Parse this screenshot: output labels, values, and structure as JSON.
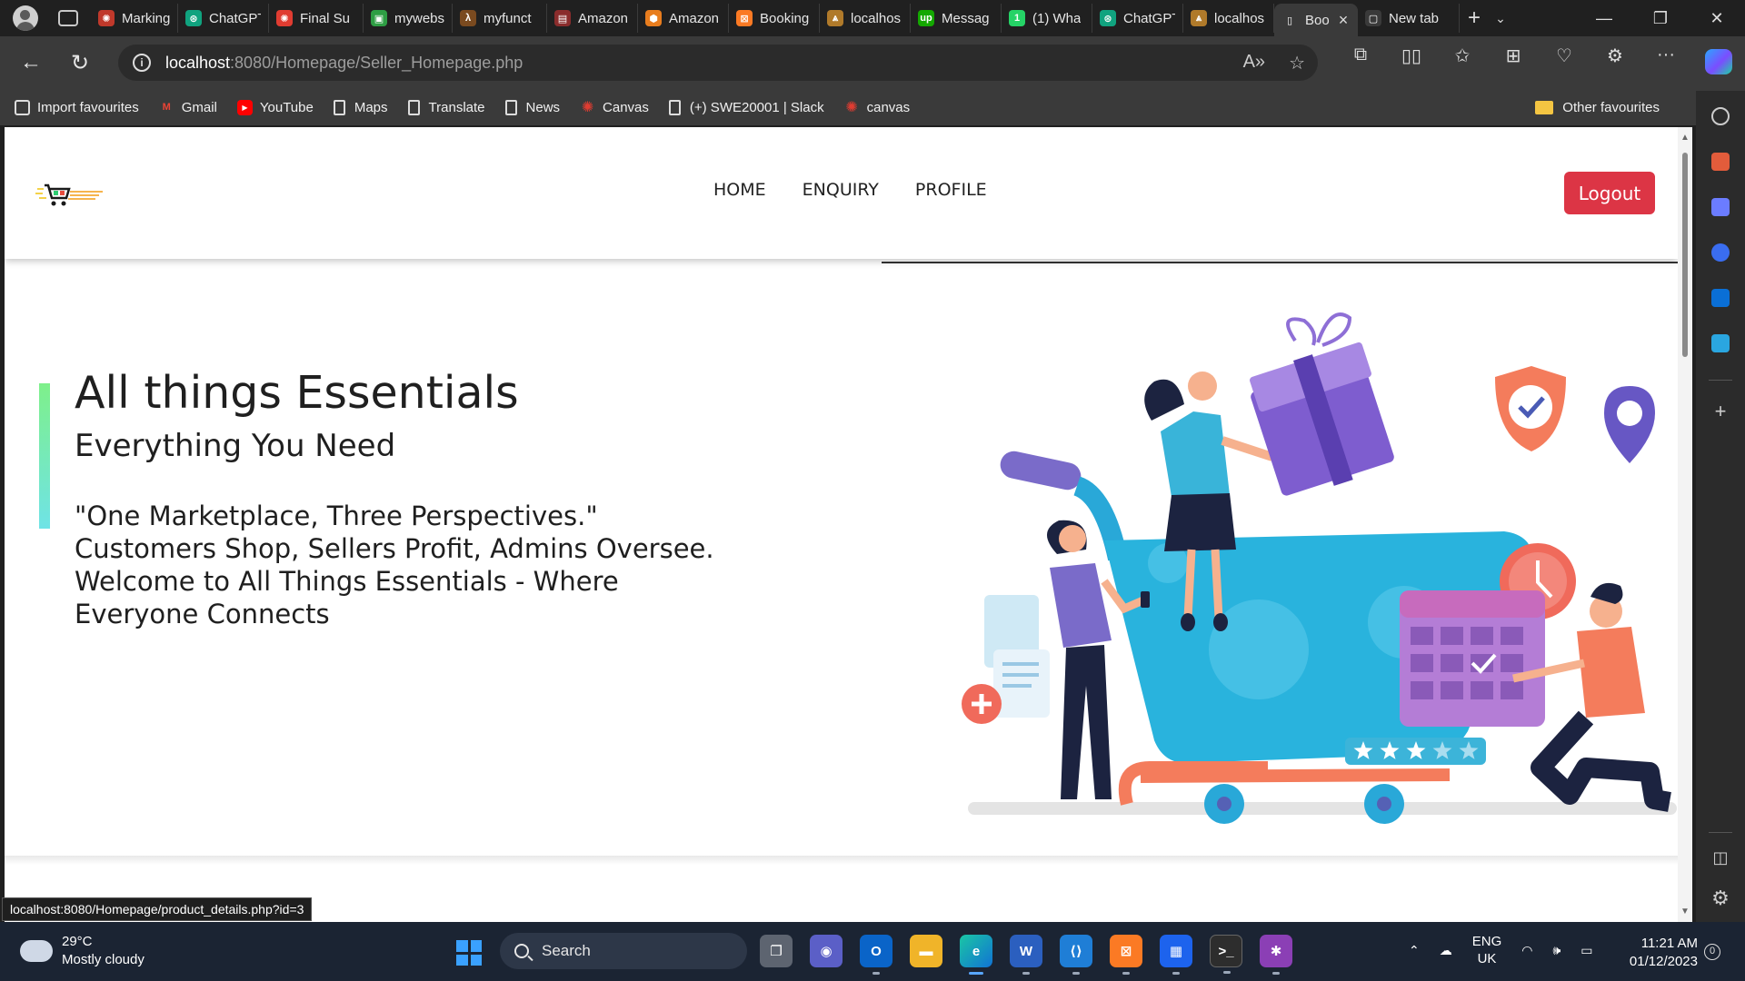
{
  "browser": {
    "tabs": [
      {
        "title": "Marking",
        "color": "#c0392b",
        "glyph": "✺"
      },
      {
        "title": "ChatGPT",
        "color": "#10a37f",
        "glyph": "⊛"
      },
      {
        "title": "Final Su",
        "color": "#e03c31",
        "glyph": "✺"
      },
      {
        "title": "mywebs",
        "color": "#2e9e44",
        "glyph": "▣"
      },
      {
        "title": "myfunct",
        "color": "#7a4a1f",
        "glyph": "λ"
      },
      {
        "title": "Amazon",
        "color": "#8a2c2c",
        "glyph": "▤"
      },
      {
        "title": "Amazon",
        "color": "#e87d1e",
        "glyph": "⬢"
      },
      {
        "title": "Booking",
        "color": "#fb7a24",
        "glyph": "⊠"
      },
      {
        "title": "localhos",
        "color": "#b07a2a",
        "glyph": "⩓"
      },
      {
        "title": "Messag",
        "color": "#14a800",
        "glyph": "up"
      },
      {
        "title": "(1) Wha",
        "color": "#25d366",
        "glyph": "1"
      },
      {
        "title": "ChatGPT",
        "color": "#10a37f",
        "glyph": "⊛"
      },
      {
        "title": "localhos",
        "color": "#b07a2a",
        "glyph": "⩓"
      },
      {
        "title": "Boo",
        "color": "#3a3a3a",
        "glyph": "▯"
      },
      {
        "title": "New tab",
        "color": "#3a3a3a",
        "glyph": "▢"
      }
    ],
    "active_tab_index": 13,
    "url_host": "localhost",
    "url_rest": ":8080/Homepage/Seller_Homepage.php",
    "favourites": [
      {
        "label": "Import favourites",
        "icon": "import-icon"
      },
      {
        "label": "Gmail",
        "icon": "gmail-icon"
      },
      {
        "label": "YouTube",
        "icon": "youtube-icon"
      },
      {
        "label": "Maps",
        "icon": "page-icon"
      },
      {
        "label": "Translate",
        "icon": "page-icon"
      },
      {
        "label": "News",
        "icon": "page-icon"
      },
      {
        "label": "Canvas",
        "icon": "canvas-icon"
      },
      {
        "label": "(+) SWE20001 | Slack",
        "icon": "page-icon"
      },
      {
        "label": "canvas",
        "icon": "canvas-icon"
      }
    ],
    "other_favourites": "Other favourites",
    "status_url": "localhost:8080/Homepage/product_details.php?id=3"
  },
  "site": {
    "menu": [
      "HOME",
      "ENQUIRY",
      "PROFILE"
    ],
    "logout_label": "Logout",
    "accent_color": "#dc3545",
    "hero": {
      "title": "All things Essentials",
      "subtitle": "Everything You Need",
      "quote": "\"One Marketplace, Three Perspectives.\" Customers Shop, Sellers Profit, Admins Oversee. Welcome to All Things Essentials - Where Everyone Connects"
    },
    "rating_stars": 3
  },
  "taskbar": {
    "weather_temp": "29°C",
    "weather_desc": "Mostly cloudy",
    "search_label": "Search",
    "lang_top": "ENG",
    "lang_bottom": "UK",
    "time": "11:21 AM",
    "date": "01/12/2023",
    "notifications": "0"
  }
}
